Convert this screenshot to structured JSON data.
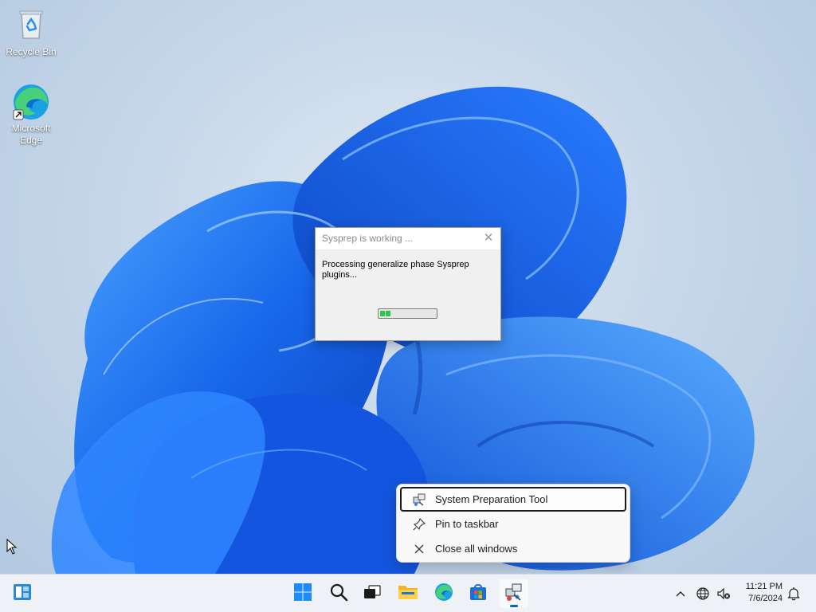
{
  "desktop": {
    "icons": [
      {
        "label": "Recycle Bin",
        "icon": "recycle-bin-icon"
      },
      {
        "label": "Microsoft Edge",
        "icon": "edge-icon"
      }
    ]
  },
  "dialog": {
    "title": "Sysprep is working ...",
    "message": "Processing generalize phase Sysprep plugins...",
    "progress_fraction": 0.12,
    "colors": {
      "progress": "#2bc64a"
    }
  },
  "context_menu": {
    "items": [
      {
        "label": "System Preparation Tool",
        "icon": "sysprep-icon",
        "focused": true
      },
      {
        "label": "Pin to taskbar",
        "icon": "pin-icon"
      },
      {
        "label": "Close all windows",
        "icon": "close-icon"
      }
    ]
  },
  "taskbar": {
    "buttons": [
      "widgets-icon",
      "start-icon",
      "search-icon",
      "task-view-icon",
      "file-explorer-icon",
      "edge-icon",
      "store-icon",
      "sysprep-icon"
    ],
    "tray": {
      "time": "11:21 PM",
      "date": "7/6/2024",
      "icons": [
        "chevron-up-icon",
        "network-icon",
        "volume-muted-icon",
        "notification-icon"
      ]
    }
  },
  "colors": {
    "accent": "#0067c0",
    "wallpaper_bloom": "#1e6cf0"
  }
}
